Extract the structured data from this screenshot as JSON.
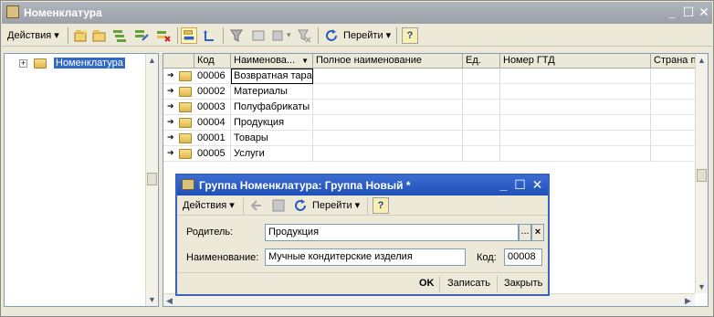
{
  "window": {
    "title": "Номенклатура"
  },
  "toolbar": {
    "actions_label": "Действия",
    "goto_label": "Перейти",
    "help_glyph": "?"
  },
  "tree": {
    "root_label": "Номенклатура"
  },
  "grid": {
    "columns": [
      "Код",
      "Наименова...",
      "Полное наименование",
      "Ед.",
      "Номер ГТД",
      "Страна п"
    ],
    "rows": [
      {
        "code": "00006",
        "name": "Возвратная тара"
      },
      {
        "code": "00002",
        "name": "Материалы"
      },
      {
        "code": "00003",
        "name": "Полуфабрикаты"
      },
      {
        "code": "00004",
        "name": "Продукция"
      },
      {
        "code": "00001",
        "name": "Товары"
      },
      {
        "code": "00005",
        "name": "Услуги"
      }
    ]
  },
  "dialog": {
    "title": "Группа Номенклатура: Группа Новый *",
    "actions_label": "Действия",
    "goto_label": "Перейти",
    "help_glyph": "?",
    "parent_label": "Родитель:",
    "parent_value": "Продукция",
    "name_label": "Наименование:",
    "name_value": "Мучные кондитерские изделия",
    "code_label": "Код:",
    "code_value": "00008",
    "ok_label": "OK",
    "save_label": "Записать",
    "close_label": "Закрыть",
    "select_glyph": "...",
    "clear_glyph": "×"
  },
  "icons": {
    "minimize": "minimize-icon",
    "maximize": "maximize-icon",
    "close": "close-icon"
  }
}
